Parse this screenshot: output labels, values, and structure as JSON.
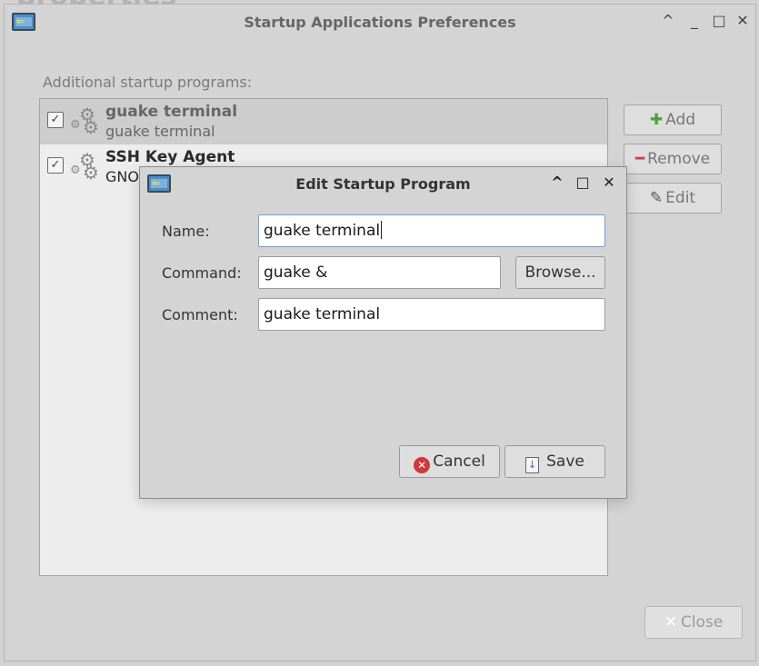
{
  "background": {
    "title": "properties"
  },
  "window": {
    "title": "Startup Applications Preferences",
    "controls": [
      "^",
      "_",
      "□",
      "✕"
    ]
  },
  "section_label": "Additional startup programs:",
  "programs": [
    {
      "name": "guake terminal",
      "comment": "guake terminal",
      "enabled": true,
      "selected": true
    },
    {
      "name": "SSH Key Agent",
      "comment": "GNO",
      "enabled": true,
      "selected": false
    }
  ],
  "side_buttons": {
    "add": "Add",
    "remove": "Remove",
    "edit": "Edit"
  },
  "close_button": "Close",
  "dialog": {
    "title": "Edit Startup Program",
    "name_label": "Name:",
    "name_value": "guake terminal",
    "command_label": "Command:",
    "command_value": "guake &",
    "browse_label": "Browse...",
    "comment_label": "Comment:",
    "comment_value": "guake terminal",
    "cancel_label": "Cancel",
    "save_label": "Save"
  },
  "colors": {
    "window_bg": "#d4d4d4",
    "list_bg": "#ededed",
    "selected_row": "#cdcdcd",
    "focus_border": "#6f9fd6",
    "cancel_red": "#d0383a",
    "add_green": "#4aa33a",
    "remove_red": "#c84040"
  },
  "icons": {
    "app": "startup-app-icon",
    "program": "gears-icon",
    "add": "plus-icon",
    "remove": "minus-icon",
    "edit": "pencil-icon",
    "cancel": "cancel-circle-icon",
    "save": "save-icon",
    "close": "close-x-icon"
  }
}
